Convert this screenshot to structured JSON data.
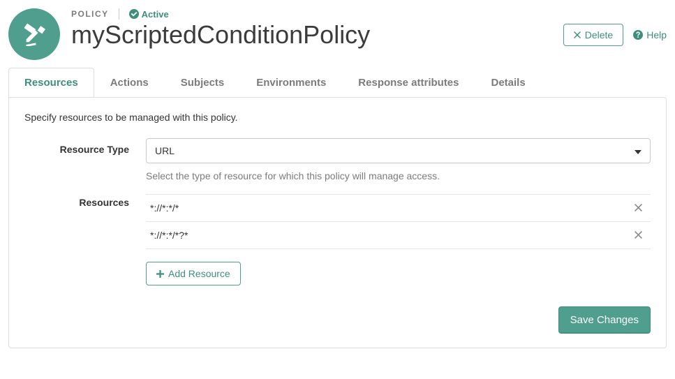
{
  "header": {
    "badge": "POLICY",
    "status": "Active",
    "title": "myScriptedConditionPolicy",
    "delete_label": "Delete",
    "help_label": "Help"
  },
  "tabs": [
    {
      "label": "Resources",
      "active": true
    },
    {
      "label": "Actions",
      "active": false
    },
    {
      "label": "Subjects",
      "active": false
    },
    {
      "label": "Environments",
      "active": false
    },
    {
      "label": "Response attributes",
      "active": false
    },
    {
      "label": "Details",
      "active": false
    }
  ],
  "panel": {
    "intro": "Specify resources to be managed with this policy.",
    "resource_type": {
      "label": "Resource Type",
      "selected": "URL",
      "hint": "Select the type of resource for which this policy will manage access."
    },
    "resources": {
      "label": "Resources",
      "items": [
        "*://*:*/*",
        "*://*:*/*?*"
      ],
      "add_label": "Add Resource"
    },
    "save_label": "Save Changes"
  }
}
